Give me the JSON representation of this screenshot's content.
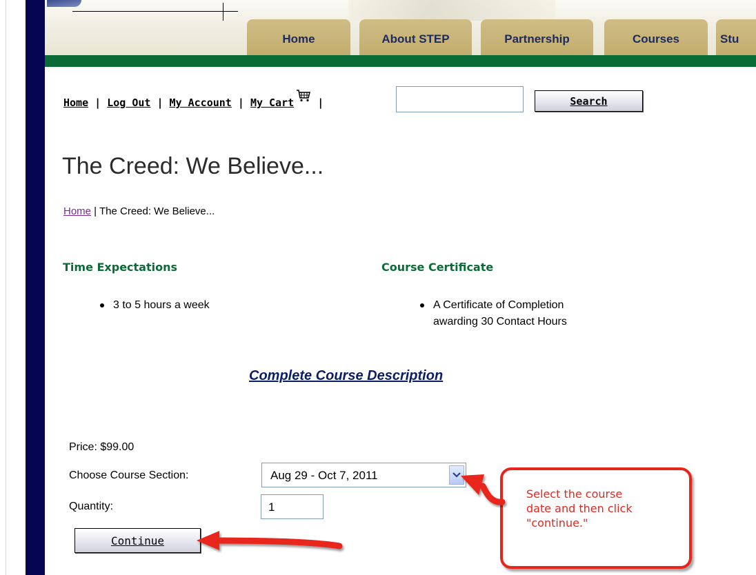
{
  "nav": {
    "tabs": [
      "Home",
      "About STEP",
      "Partnership",
      "Courses",
      "Stu"
    ]
  },
  "utility": {
    "home": "Home",
    "logout": "Log Out",
    "account": "My Account",
    "cart": "My Cart",
    "sep": "|",
    "search_value": "",
    "search_button": "Search"
  },
  "page": {
    "title": "The Creed: We Believe...",
    "breadcrumb_home": "Home",
    "breadcrumb_current": " | The Creed: We Believe..."
  },
  "details": {
    "time_heading": "Time Expectations",
    "time_item": "3 to 5 hours a week",
    "cert_heading": "Course Certificate",
    "cert_item_line1": "A Certificate of Completion",
    "cert_item_line2": "awarding 30 Contact Hours",
    "description_link": "Complete Course Description"
  },
  "purchase": {
    "price": "Price: $99.00",
    "section_label": "Choose Course Section:",
    "section_value": "Aug 29 - Oct 7, 2011",
    "quantity_label": "Quantity:",
    "quantity_value": "1",
    "continue_button": "Continue"
  },
  "annotation": {
    "text_line1": "Select the course",
    "text_line2": "date and then click",
    "text_line3": "\"continue.\""
  },
  "colors": {
    "accent_green": "#0b6b36",
    "nav_blue": "#1e2a60",
    "side_stripe": "#05064f",
    "callout_red": "#e8251c"
  }
}
